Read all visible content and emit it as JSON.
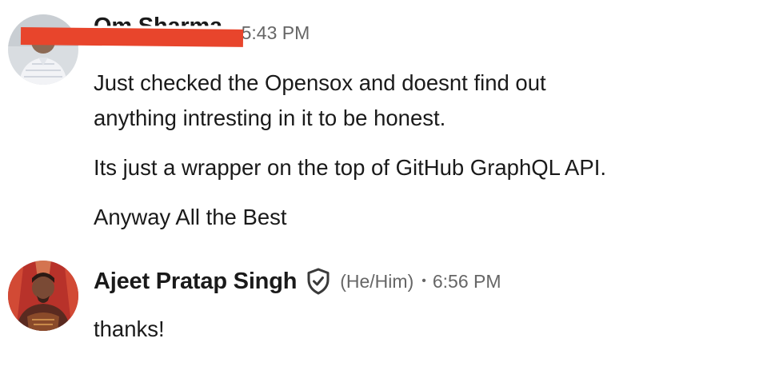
{
  "messages": [
    {
      "author": "Om Sharma",
      "time": "5:43 PM",
      "separator": "•",
      "paragraphs": [
        {
          "lines": [
            "Just checked the Opensox and doesnt find out",
            "anything intresting in it to be honest."
          ]
        },
        {
          "lines": [
            "Its just a wrapper on the top of GitHub GraphQL API."
          ]
        },
        {
          "lines": [
            "Anyway All the Best"
          ]
        }
      ],
      "redaction_color": "#e8452c"
    },
    {
      "author": "Ajeet Pratap Singh",
      "verified_icon": "shield-check-icon",
      "pronouns": "(He/Him)",
      "separator": "•",
      "time": "6:56 PM",
      "paragraphs": [
        {
          "lines": [
            "thanks!"
          ]
        }
      ]
    }
  ],
  "colors": {
    "text": "#1a1a1a",
    "meta": "#666666",
    "avatar2_bg": "#b8322a"
  }
}
